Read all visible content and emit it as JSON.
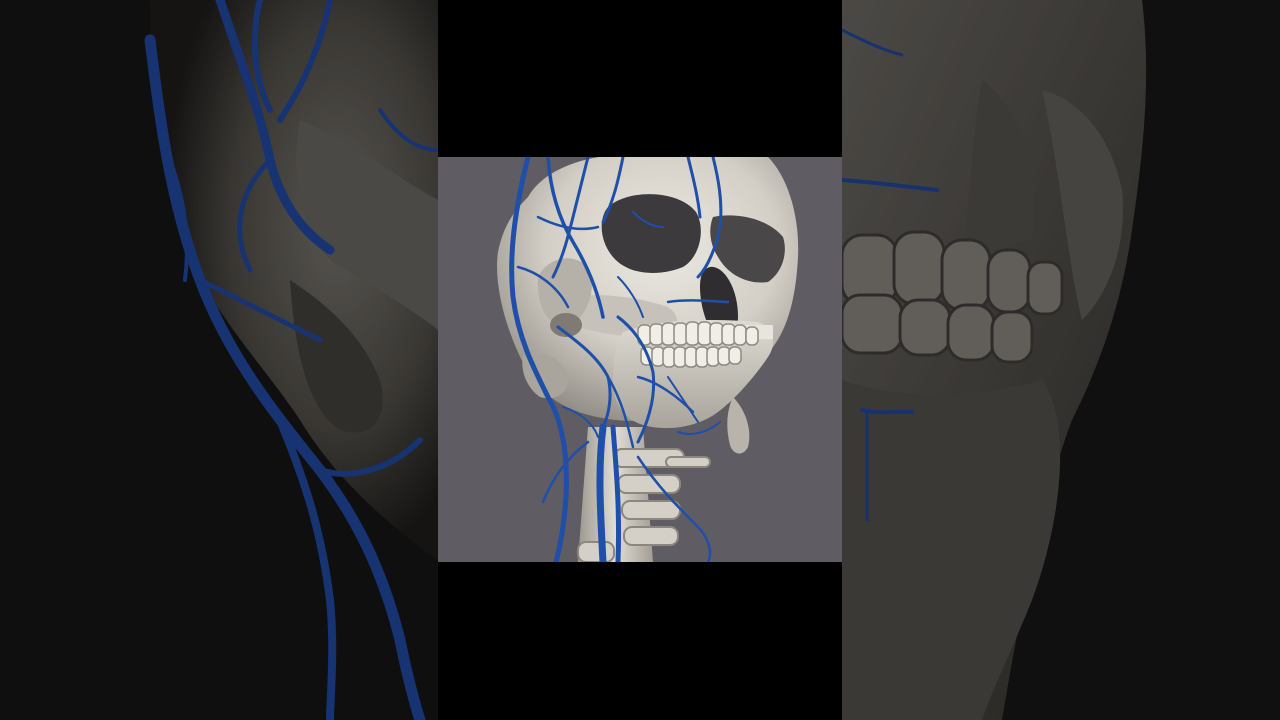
{
  "scene": {
    "subject": "skull-with-veins-3d-render",
    "colors": {
      "background_outer": "#0f0f0f",
      "letterbox": "#000000",
      "render_background": "#5f5d63",
      "bone": "#d9d6cf",
      "bone_shadow": "#8f8b84",
      "vein": "#1f4fa8",
      "vein_dark": "#123270"
    }
  }
}
